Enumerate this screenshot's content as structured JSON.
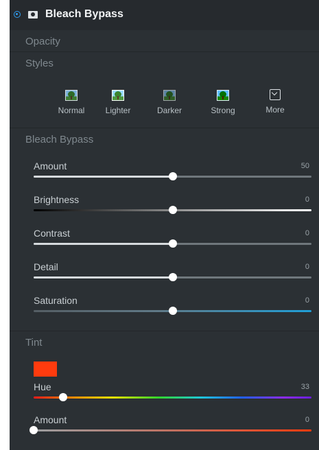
{
  "header": {
    "title": "Bleach Bypass"
  },
  "sections": {
    "opacity": "Opacity",
    "styles": "Styles",
    "bleach": "Bleach Bypass",
    "tint": "Tint"
  },
  "styles": [
    {
      "label": "Normal",
      "icon": "tree-thumbnail-icon"
    },
    {
      "label": "Lighter",
      "icon": "tree-thumbnail-icon"
    },
    {
      "label": "Darker",
      "icon": "tree-thumbnail-icon"
    },
    {
      "label": "Strong",
      "icon": "tree-thumbnail-icon"
    },
    {
      "label": "More",
      "icon": "chevron-down-box-icon"
    }
  ],
  "sliders": [
    {
      "label": "Amount",
      "value": "50",
      "position": 0.5
    },
    {
      "label": "Brightness",
      "value": "0",
      "position": 0.5
    },
    {
      "label": "Contrast",
      "value": "0",
      "position": 0.5
    },
    {
      "label": "Detail",
      "value": "0",
      "position": 0.5
    },
    {
      "label": "Saturation",
      "value": "0",
      "position": 0.5
    }
  ],
  "tint": {
    "swatch_color": "#ff3b0e",
    "hue": {
      "label": "Hue",
      "value": "33",
      "position": 0.105
    },
    "amount": {
      "label": "Amount",
      "value": "0",
      "position": 0.0
    }
  },
  "colors": {
    "panel": "#2b3034",
    "accent": "#2f9cf0",
    "text": "#c8ced2",
    "muted": "#7f888e"
  }
}
